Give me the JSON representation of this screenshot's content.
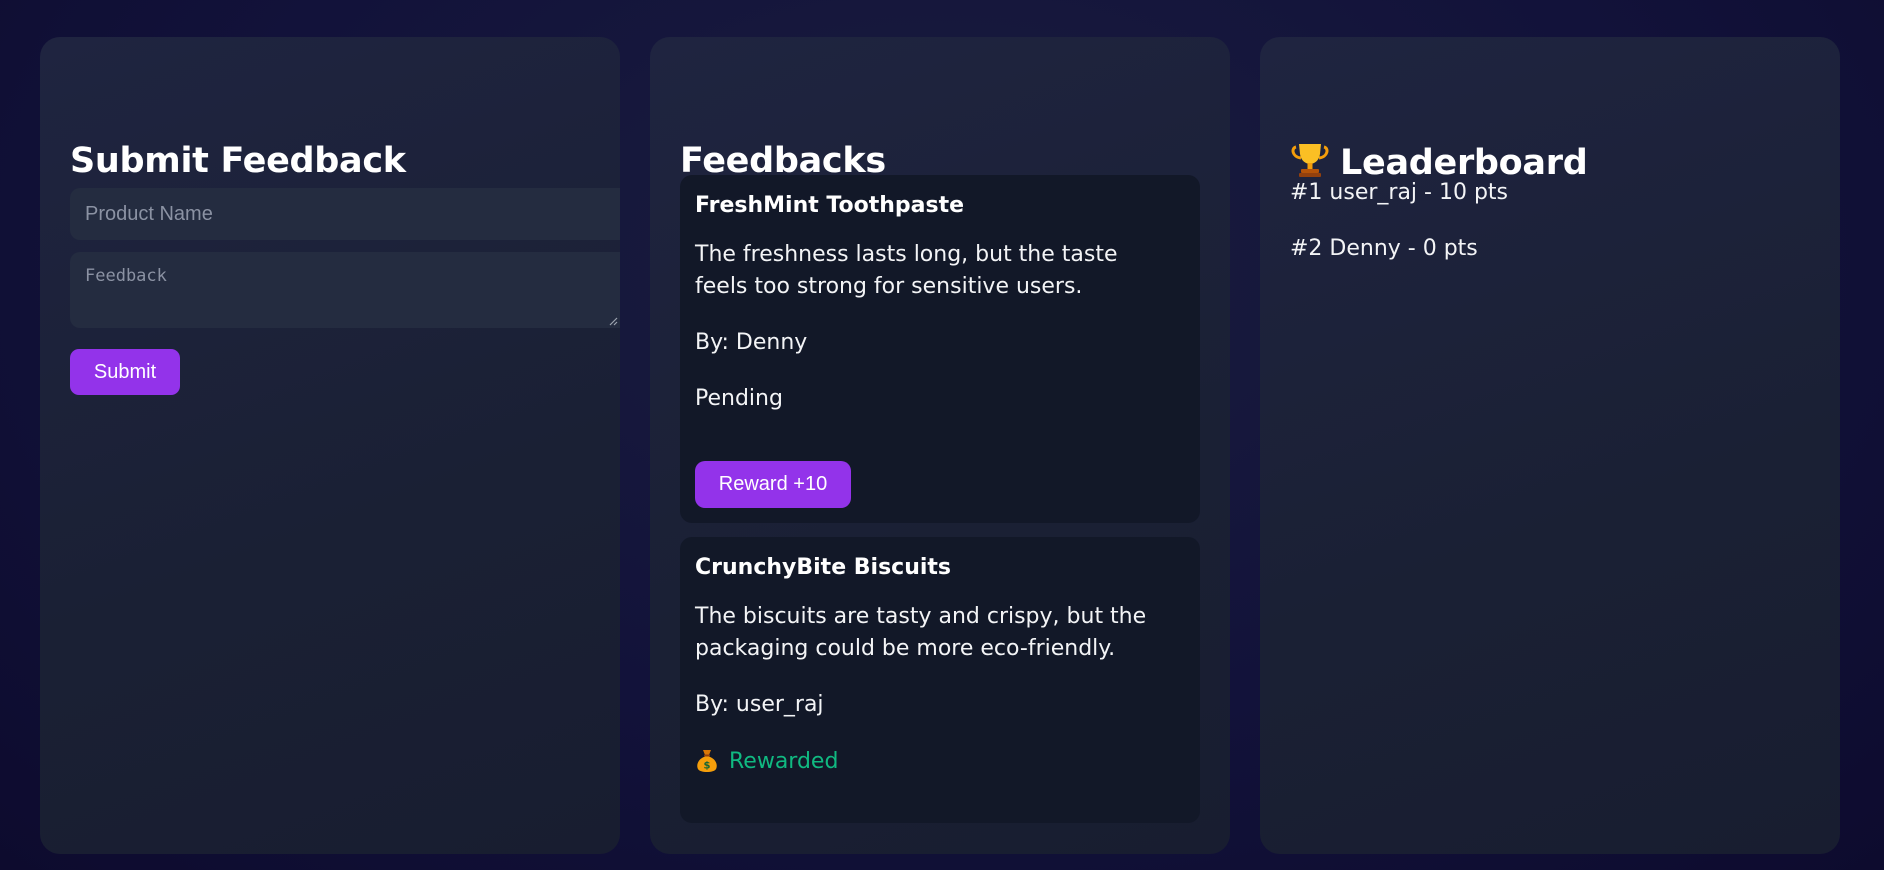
{
  "submit_panel": {
    "title": "Submit Feedback",
    "product_placeholder": "Product Name",
    "feedback_placeholder": "Feedback",
    "submit_label": "Submit"
  },
  "feedbacks_panel": {
    "title": "Feedbacks",
    "items": [
      {
        "product": "FreshMint Toothpaste",
        "text": "The freshness lasts long, but the taste feels too strong for sensitive users.",
        "author": "By: Denny",
        "status": "Pending",
        "action_label": "Reward +10"
      },
      {
        "product": "CrunchyBite Biscuits",
        "text": "The biscuits are tasty and crispy, but the packaging could be more eco-friendly.",
        "author": "By: user_raj",
        "status": "Rewarded",
        "status_icon": "money-bag-icon"
      }
    ]
  },
  "leaderboard_panel": {
    "title": "Leaderboard",
    "title_icon": "trophy-icon",
    "entries": [
      "#1 user_raj - 10 pts",
      "#2 Denny - 0 pts"
    ]
  },
  "colors": {
    "accent": "#9333ea",
    "success": "#10b981",
    "panel": "#1d2238",
    "card": "#121828"
  }
}
